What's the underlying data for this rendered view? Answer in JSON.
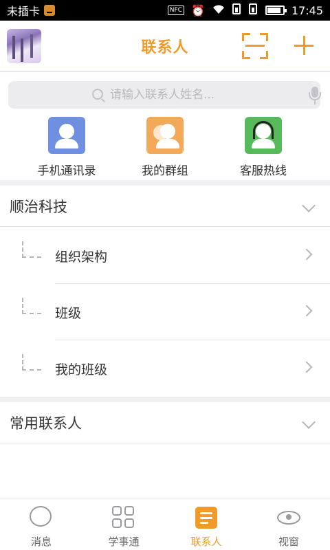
{
  "status_bar": {
    "carrier": "未插卡",
    "nfc": "NFC",
    "time": "17:45",
    "battery_level": 0.8
  },
  "header": {
    "title": "联系人",
    "accent_color": "#f29a29"
  },
  "search": {
    "placeholder": "请输入联系人姓名..."
  },
  "quick_actions": [
    {
      "label": "手机通讯录",
      "icon": "contact-card-icon",
      "color": "#6f8fe0"
    },
    {
      "label": "我的群组",
      "icon": "group-icon",
      "color": "#f2aa5a"
    },
    {
      "label": "客服热线",
      "icon": "headset-icon",
      "color": "#56b95a"
    }
  ],
  "groups": [
    {
      "name": "顺治科技",
      "expanded": true,
      "items": [
        {
          "label": "组织架构"
        },
        {
          "label": "班级"
        },
        {
          "label": "我的班级"
        }
      ]
    },
    {
      "name": "常用联系人",
      "expanded": false
    }
  ],
  "bottom_nav": [
    {
      "label": "消息",
      "icon": "chat-icon",
      "active": false
    },
    {
      "label": "学事通",
      "icon": "grid-icon",
      "active": false
    },
    {
      "label": "联系人",
      "icon": "contacts-icon",
      "active": true
    },
    {
      "label": "视窗",
      "icon": "eye-icon",
      "active": false
    }
  ]
}
